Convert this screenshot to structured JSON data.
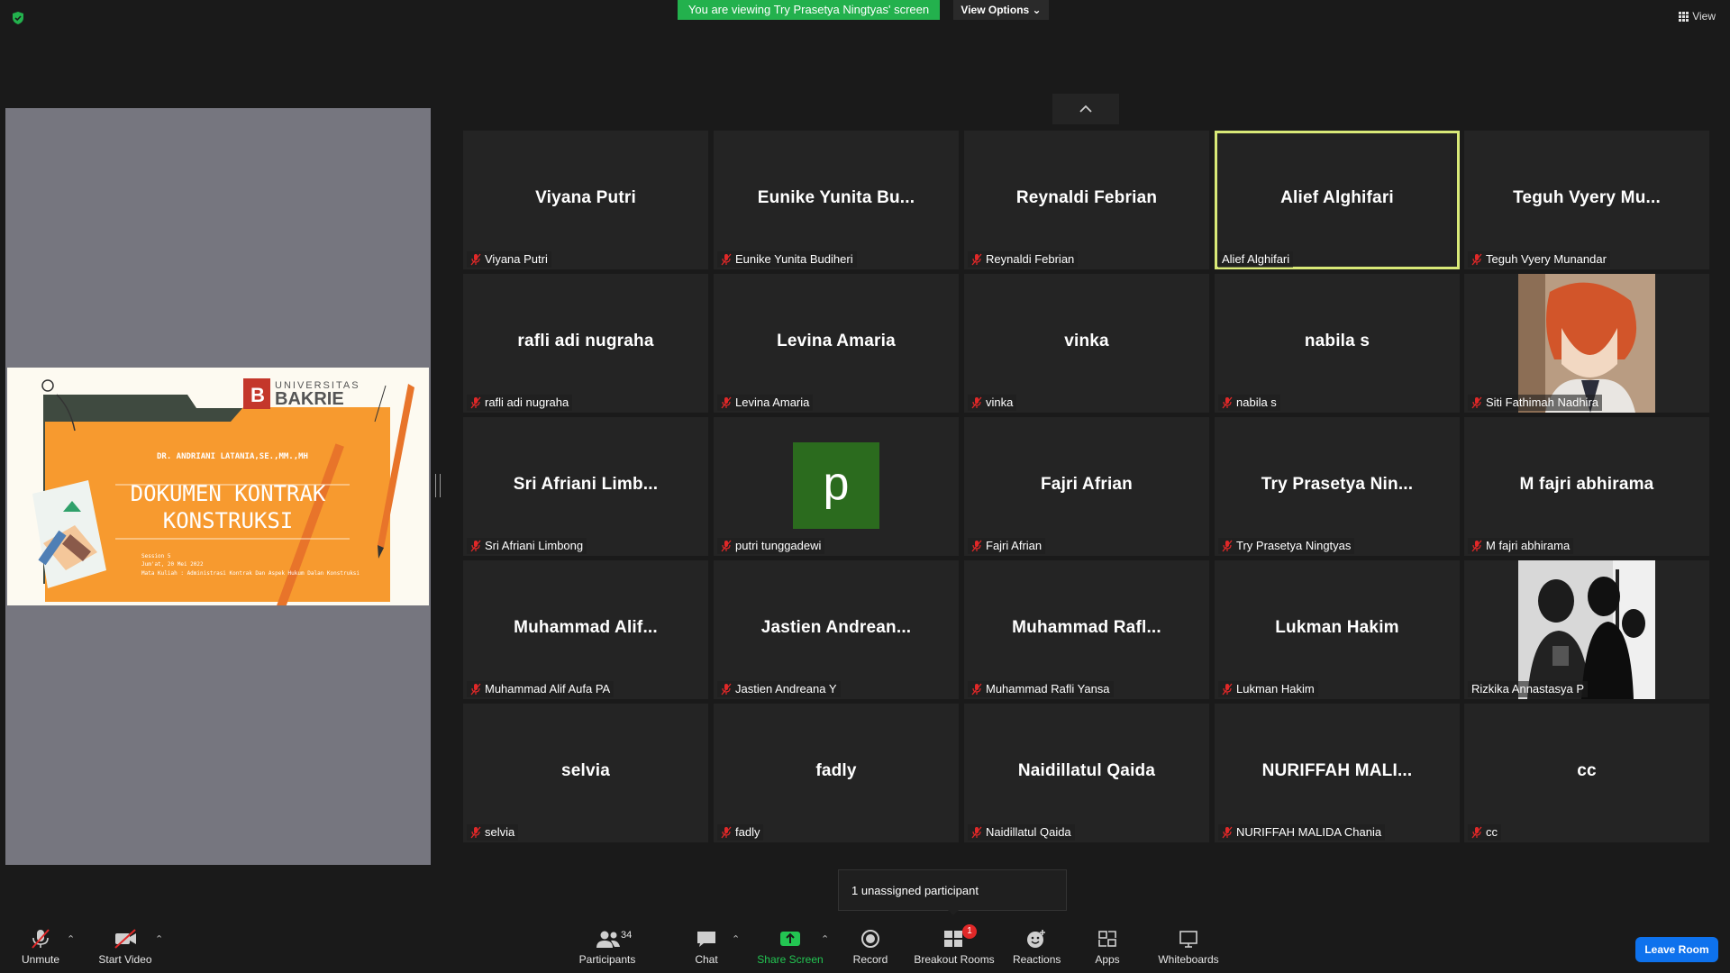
{
  "top": {
    "banner": "You are viewing Try Prasetya Ningtyas' screen",
    "view_options": "View Options ⌄",
    "view": "View"
  },
  "slide": {
    "logo_top": "UNIVERSITAS",
    "logo_bottom": "BAKRIE",
    "author": "DR. ANDRIANI LATANIA,SE.,MM.,MH",
    "title_line1": "DOKUMEN KONTRAK",
    "title_line2": "KONSTRUKSI",
    "session": "Session 5",
    "date": "Jum'at, 20 Mei 2022",
    "course": "Mata Kuliah : Administrasi Kontrak Dan Aspek Hukum Dalan Konstruksi"
  },
  "tiles": [
    {
      "big": "Viyana Putri",
      "label": "Viyana Putri",
      "muted": true
    },
    {
      "big": "Eunike Yunita Bu...",
      "label": "Eunike Yunita Budiheri",
      "muted": true
    },
    {
      "big": "Reynaldi Febrian",
      "label": "Reynaldi Febrian",
      "muted": true
    },
    {
      "big": "Alief Alghifari",
      "label": "Alief Alghifari",
      "muted": false,
      "active": true
    },
    {
      "big": "Teguh Vyery Mu...",
      "label": "Teguh Vyery Munandar",
      "muted": true
    },
    {
      "big": "rafli adi nugraha",
      "label": "rafli adi nugraha",
      "muted": true
    },
    {
      "big": "Levina Amaria",
      "label": "Levina Amaria",
      "muted": true
    },
    {
      "big": "vinka",
      "label": "vinka",
      "muted": true
    },
    {
      "big": "nabila s",
      "label": "nabila s",
      "muted": true
    },
    {
      "big": "",
      "label": "Siti Fathimah Nadhira",
      "muted": true,
      "photo": "anime"
    },
    {
      "big": "Sri Afriani Limb...",
      "label": "Sri Afriani Limbong",
      "muted": true
    },
    {
      "big": "",
      "label": "putri tunggadewi",
      "muted": true,
      "avatar": "p"
    },
    {
      "big": "Fajri Afrian",
      "label": "Fajri Afrian",
      "muted": true
    },
    {
      "big": "Try Prasetya Nin...",
      "label": "Try Prasetya Ningtyas",
      "muted": true
    },
    {
      "big": "M fajri abhirama",
      "label": "M fajri abhirama",
      "muted": true
    },
    {
      "big": "Muhammad Alif...",
      "label": "Muhammad Alif Aufa PA",
      "muted": true
    },
    {
      "big": "Jastien Andrean...",
      "label": "Jastien Andreana Y",
      "muted": true
    },
    {
      "big": "Muhammad Rafl...",
      "label": "Muhammad Rafli Yansa",
      "muted": true
    },
    {
      "big": "Lukman Hakim",
      "label": "Lukman Hakim",
      "muted": true
    },
    {
      "big": "",
      "label": "Rizkika Annastasya P",
      "muted": false,
      "photo": "group"
    },
    {
      "big": "selvia",
      "label": "selvia",
      "muted": true
    },
    {
      "big": "fadly",
      "label": "fadly",
      "muted": true
    },
    {
      "big": "Naidillatul Qaida",
      "label": "Naidillatul Qaida",
      "muted": true
    },
    {
      "big": "NURIFFAH MALI...",
      "label": "NURIFFAH MALIDA Chania",
      "muted": true
    },
    {
      "big": "cc",
      "label": "cc",
      "muted": true
    }
  ],
  "tooltip": "1 unassigned participant",
  "toolbar": {
    "unmute": "Unmute",
    "start_video": "Start Video",
    "participants": "Participants",
    "participants_count": "34",
    "chat": "Chat",
    "share_screen": "Share Screen",
    "record": "Record",
    "breakout_rooms": "Breakout Rooms",
    "breakout_badge": "1",
    "reactions": "Reactions",
    "apps": "Apps",
    "whiteboards": "Whiteboards",
    "leave_room": "Leave Room"
  },
  "colors": {
    "banner": "#23b14d",
    "active_speaker": "#d9e978",
    "share_green": "#23c552",
    "leave": "#0e72ed",
    "mute_red": "#e02828"
  }
}
